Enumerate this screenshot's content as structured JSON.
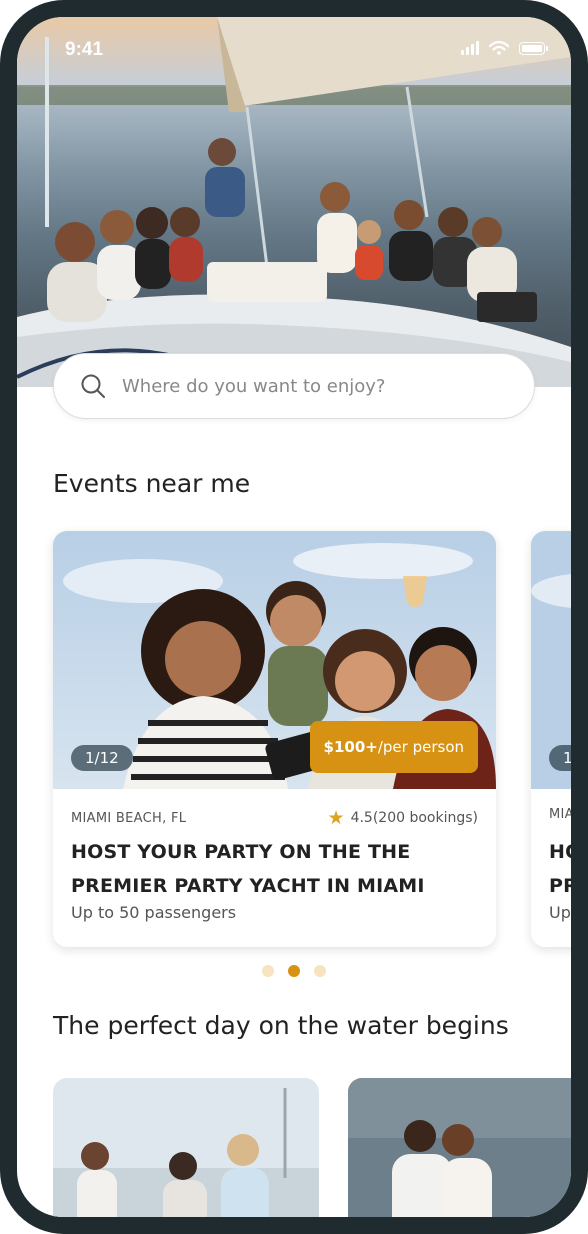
{
  "status_bar": {
    "time": "9:41"
  },
  "search": {
    "placeholder": "Where do you want to enjoy?"
  },
  "events_section": {
    "title": "Events near me"
  },
  "event_card": {
    "image_counter": "1/12",
    "price_amount": "$100+",
    "price_unit": "/per person",
    "location": "MIAMI BEACH, FL",
    "rating": "4.5",
    "bookings": "(200 bookings)",
    "title": "HOST YOUR PARTY ON THE THE PREMIER PARTY YACHT IN MIAMI",
    "subtitle": "Up to 50 passengers"
  },
  "event_card_next": {
    "location": "MIA",
    "title_line1": "HO",
    "title_line2": "PR",
    "subtitle": "Up",
    "image_counter": "1"
  },
  "carousel": {
    "pages": 3,
    "active_index": 1
  },
  "day_section": {
    "title": "The perfect day on the water begins"
  },
  "colors": {
    "accent": "#d89213",
    "device_frame": "#1f2b2e",
    "dot_inactive": "#f7e3c0"
  }
}
